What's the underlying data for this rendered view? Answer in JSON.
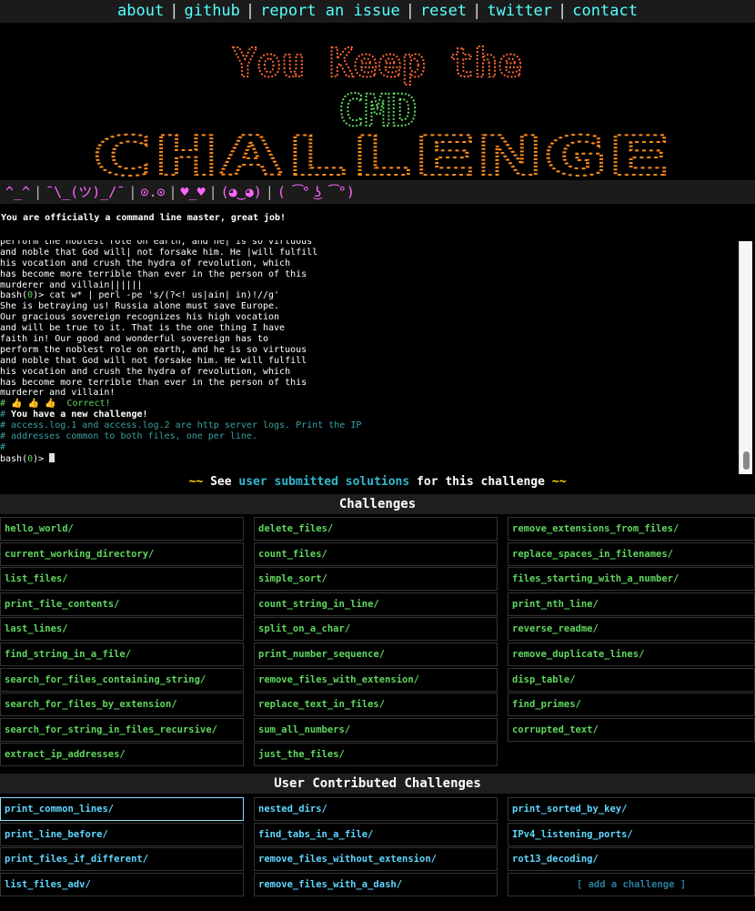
{
  "nav": {
    "items": [
      "about",
      "github",
      "report an issue",
      "reset",
      "twitter",
      "contact"
    ],
    "separator": "|"
  },
  "banner": {
    "title_line1": "You Keep the",
    "title_line2": "CMD",
    "title_line3": "CHALLENGE",
    "colors": [
      "#ff6633",
      "#ffd23f",
      "#5fd75f",
      "#ff3fa0",
      "#3aa0ff",
      "#ff8c1a"
    ]
  },
  "emoticons": [
    "^_^",
    "¯\\_(ツ)_/¯",
    "⊙.⊙",
    "♥_♥",
    "(◕‿◕)",
    "( ͡° ͜ʖ ͡°)"
  ],
  "status_message": "You are officially a command line master, great job!",
  "terminal": {
    "lines": [
      "perform the noblest role on earth, and he| is so virtuous",
      "and noble that God will| not forsake him. He |will fulfill",
      "his vocation and crush the hydra of revolution, which",
      "has become more terrible than ever in the person of this",
      "murderer and villain||||||",
      "bash(0)> cat w* | perl -pe 's/(?<! us|ain| in)!//g'",
      "She is betraying us! Russia alone must save Europe.",
      "Our gracious sovereign recognizes his high vocation",
      "and will be true to it. That is the one thing I have",
      "faith in! Our good and wonderful sovereign has to",
      "perform the noblest role on earth, and he is so virtuous",
      "and noble that God will not forsake him. He will fulfill",
      "his vocation and crush the hydra of revolution, which",
      "has become more terrible than ever in the person of this",
      "murderer and villain!"
    ],
    "correct_line": "# 👍 👍 👍  Correct!",
    "new_challenge": "You have a new challenge!",
    "challenge_text_1": "access.log.1 and access.log.2 are http server logs. Print the IP",
    "challenge_text_2": "addresses common to both files, one per line.",
    "hash": "#",
    "prompt_prefix": "bash(",
    "prompt_code": "0",
    "prompt_suffix": ")>"
  },
  "see_line": {
    "tilde_left": "~~",
    "see": "See",
    "link": "user submitted solutions",
    "rest": "for this challenge",
    "tilde_right": "~~"
  },
  "challenges_header": "Challenges",
  "challenges": [
    [
      "hello_world/",
      "delete_files/",
      "remove_extensions_from_files/"
    ],
    [
      "current_working_directory/",
      "count_files/",
      "replace_spaces_in_filenames/"
    ],
    [
      "list_files/",
      "simple_sort/",
      "files_starting_with_a_number/"
    ],
    [
      "print_file_contents/",
      "count_string_in_line/",
      "print_nth_line/"
    ],
    [
      "last_lines/",
      "split_on_a_char/",
      "reverse_readme/"
    ],
    [
      "find_string_in_a_file/",
      "print_number_sequence/",
      "remove_duplicate_lines/"
    ],
    [
      "search_for_files_containing_string/",
      "remove_files_with_extension/",
      "disp_table/"
    ],
    [
      "search_for_files_by_extension/",
      "replace_text_in_files/",
      "find_primes/"
    ],
    [
      "search_for_string_in_files_recursive/",
      "sum_all_numbers/",
      "corrupted_text/"
    ],
    [
      "extract_ip_addresses/",
      "just_the_files/",
      ""
    ]
  ],
  "user_header": "User Contributed Challenges",
  "user_challenges": [
    [
      "print_common_lines/",
      "nested_dirs/",
      "print_sorted_by_key/"
    ],
    [
      "print_line_before/",
      "find_tabs_in_a_file/",
      "IPv4_listening_ports/"
    ],
    [
      "print_files_if_different/",
      "remove_files_without_extension/",
      "rot13_decoding/"
    ],
    [
      "list_files_adv/",
      "remove_files_with_a_dash/",
      "[ add a challenge ]"
    ]
  ]
}
